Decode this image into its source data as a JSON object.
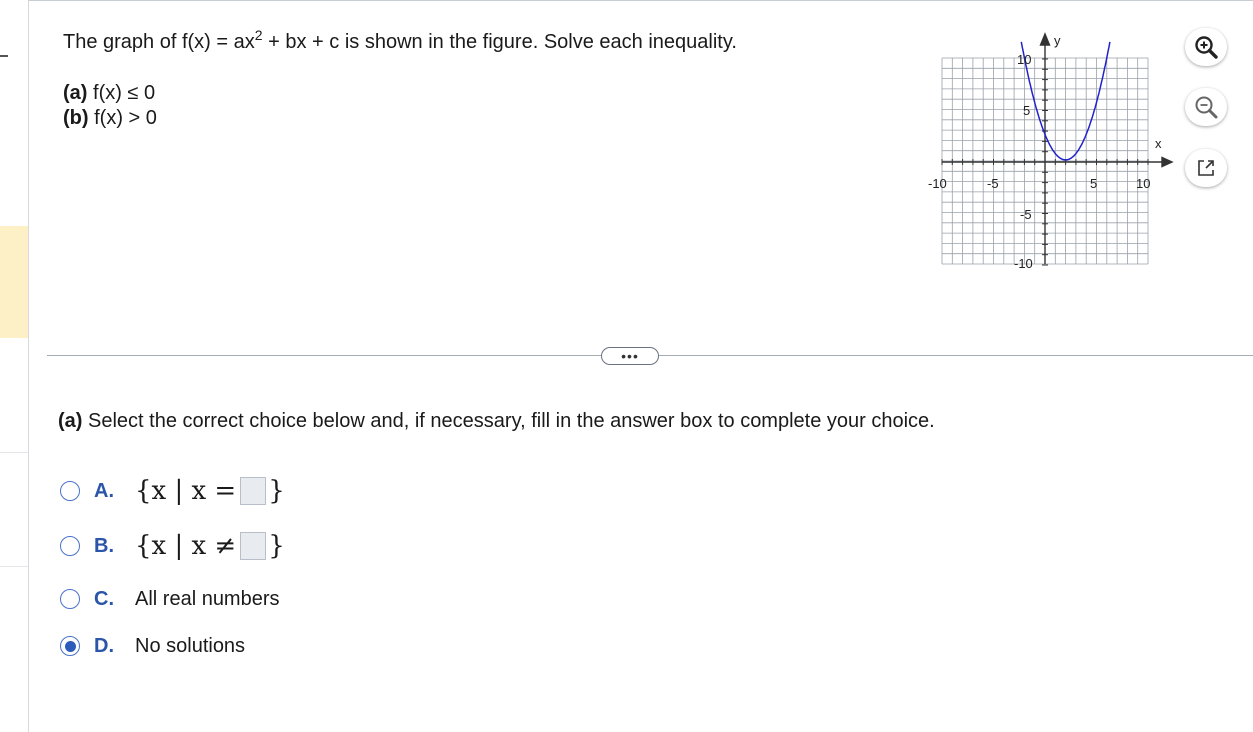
{
  "question": {
    "intro_before": "The graph of f(x) = ax",
    "exponent": "2",
    "intro_after": " + bx + c is shown in the figure. Solve each inequality.",
    "parts": [
      {
        "label": "(a)",
        "text": " f(x) ≤ 0"
      },
      {
        "label": "(b)",
        "text": " f(x) > 0"
      }
    ]
  },
  "graph": {
    "x_axis_label": "x",
    "y_axis_label": "y",
    "x_tick_labels": [
      "-10",
      "-5",
      "5",
      "10"
    ],
    "y_tick_labels": [
      "10",
      "5",
      "-5",
      "-10"
    ],
    "curve_color": "#2222cc"
  },
  "tools": {
    "zoom_in": "zoom-in-icon",
    "zoom_out": "zoom-out-icon",
    "popout": "popout-icon"
  },
  "divider": {
    "more_label": "•••"
  },
  "section_a": {
    "label": "(a)",
    "instruction": " Select the correct choice below and, if necessary, fill in the answer box to complete your choice."
  },
  "choices": [
    {
      "letter": "A.",
      "prefix": "{x | x =",
      "suffix": "}",
      "text": "",
      "selected": false
    },
    {
      "letter": "B.",
      "prefix": "{x | x ≠",
      "suffix": "}",
      "text": "",
      "selected": false
    },
    {
      "letter": "C.",
      "prefix": "",
      "suffix": "",
      "text": "All real numbers",
      "selected": false
    },
    {
      "letter": "D.",
      "prefix": "",
      "suffix": "",
      "text": "No solutions",
      "selected": true
    }
  ],
  "colors": {
    "accent": "#2a55a8",
    "highlight": "#fdf0c6"
  }
}
